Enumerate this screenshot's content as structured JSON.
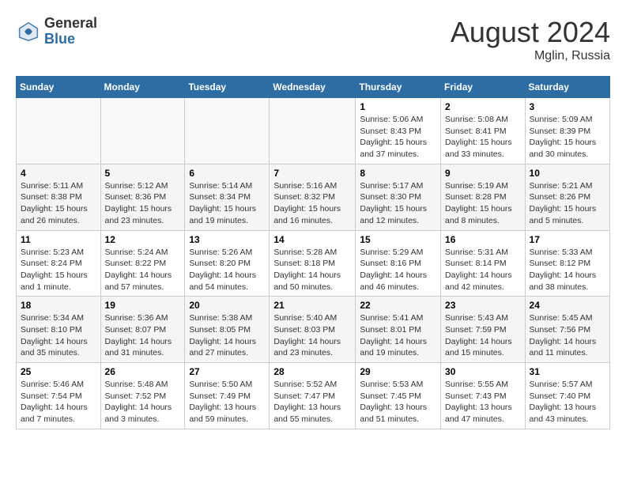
{
  "header": {
    "logo_general": "General",
    "logo_blue": "Blue",
    "title": "August 2024",
    "location": "Mglin, Russia"
  },
  "days_of_week": [
    "Sunday",
    "Monday",
    "Tuesday",
    "Wednesday",
    "Thursday",
    "Friday",
    "Saturday"
  ],
  "weeks": [
    [
      {
        "day": "",
        "info": ""
      },
      {
        "day": "",
        "info": ""
      },
      {
        "day": "",
        "info": ""
      },
      {
        "day": "",
        "info": ""
      },
      {
        "day": "1",
        "info": "Sunrise: 5:06 AM\nSunset: 8:43 PM\nDaylight: 15 hours\nand 37 minutes."
      },
      {
        "day": "2",
        "info": "Sunrise: 5:08 AM\nSunset: 8:41 PM\nDaylight: 15 hours\nand 33 minutes."
      },
      {
        "day": "3",
        "info": "Sunrise: 5:09 AM\nSunset: 8:39 PM\nDaylight: 15 hours\nand 30 minutes."
      }
    ],
    [
      {
        "day": "4",
        "info": "Sunrise: 5:11 AM\nSunset: 8:38 PM\nDaylight: 15 hours\nand 26 minutes."
      },
      {
        "day": "5",
        "info": "Sunrise: 5:12 AM\nSunset: 8:36 PM\nDaylight: 15 hours\nand 23 minutes."
      },
      {
        "day": "6",
        "info": "Sunrise: 5:14 AM\nSunset: 8:34 PM\nDaylight: 15 hours\nand 19 minutes."
      },
      {
        "day": "7",
        "info": "Sunrise: 5:16 AM\nSunset: 8:32 PM\nDaylight: 15 hours\nand 16 minutes."
      },
      {
        "day": "8",
        "info": "Sunrise: 5:17 AM\nSunset: 8:30 PM\nDaylight: 15 hours\nand 12 minutes."
      },
      {
        "day": "9",
        "info": "Sunrise: 5:19 AM\nSunset: 8:28 PM\nDaylight: 15 hours\nand 8 minutes."
      },
      {
        "day": "10",
        "info": "Sunrise: 5:21 AM\nSunset: 8:26 PM\nDaylight: 15 hours\nand 5 minutes."
      }
    ],
    [
      {
        "day": "11",
        "info": "Sunrise: 5:23 AM\nSunset: 8:24 PM\nDaylight: 15 hours\nand 1 minute."
      },
      {
        "day": "12",
        "info": "Sunrise: 5:24 AM\nSunset: 8:22 PM\nDaylight: 14 hours\nand 57 minutes."
      },
      {
        "day": "13",
        "info": "Sunrise: 5:26 AM\nSunset: 8:20 PM\nDaylight: 14 hours\nand 54 minutes."
      },
      {
        "day": "14",
        "info": "Sunrise: 5:28 AM\nSunset: 8:18 PM\nDaylight: 14 hours\nand 50 minutes."
      },
      {
        "day": "15",
        "info": "Sunrise: 5:29 AM\nSunset: 8:16 PM\nDaylight: 14 hours\nand 46 minutes."
      },
      {
        "day": "16",
        "info": "Sunrise: 5:31 AM\nSunset: 8:14 PM\nDaylight: 14 hours\nand 42 minutes."
      },
      {
        "day": "17",
        "info": "Sunrise: 5:33 AM\nSunset: 8:12 PM\nDaylight: 14 hours\nand 38 minutes."
      }
    ],
    [
      {
        "day": "18",
        "info": "Sunrise: 5:34 AM\nSunset: 8:10 PM\nDaylight: 14 hours\nand 35 minutes."
      },
      {
        "day": "19",
        "info": "Sunrise: 5:36 AM\nSunset: 8:07 PM\nDaylight: 14 hours\nand 31 minutes."
      },
      {
        "day": "20",
        "info": "Sunrise: 5:38 AM\nSunset: 8:05 PM\nDaylight: 14 hours\nand 27 minutes."
      },
      {
        "day": "21",
        "info": "Sunrise: 5:40 AM\nSunset: 8:03 PM\nDaylight: 14 hours\nand 23 minutes."
      },
      {
        "day": "22",
        "info": "Sunrise: 5:41 AM\nSunset: 8:01 PM\nDaylight: 14 hours\nand 19 minutes."
      },
      {
        "day": "23",
        "info": "Sunrise: 5:43 AM\nSunset: 7:59 PM\nDaylight: 14 hours\nand 15 minutes."
      },
      {
        "day": "24",
        "info": "Sunrise: 5:45 AM\nSunset: 7:56 PM\nDaylight: 14 hours\nand 11 minutes."
      }
    ],
    [
      {
        "day": "25",
        "info": "Sunrise: 5:46 AM\nSunset: 7:54 PM\nDaylight: 14 hours\nand 7 minutes."
      },
      {
        "day": "26",
        "info": "Sunrise: 5:48 AM\nSunset: 7:52 PM\nDaylight: 14 hours\nand 3 minutes."
      },
      {
        "day": "27",
        "info": "Sunrise: 5:50 AM\nSunset: 7:49 PM\nDaylight: 13 hours\nand 59 minutes."
      },
      {
        "day": "28",
        "info": "Sunrise: 5:52 AM\nSunset: 7:47 PM\nDaylight: 13 hours\nand 55 minutes."
      },
      {
        "day": "29",
        "info": "Sunrise: 5:53 AM\nSunset: 7:45 PM\nDaylight: 13 hours\nand 51 minutes."
      },
      {
        "day": "30",
        "info": "Sunrise: 5:55 AM\nSunset: 7:43 PM\nDaylight: 13 hours\nand 47 minutes."
      },
      {
        "day": "31",
        "info": "Sunrise: 5:57 AM\nSunset: 7:40 PM\nDaylight: 13 hours\nand 43 minutes."
      }
    ]
  ]
}
